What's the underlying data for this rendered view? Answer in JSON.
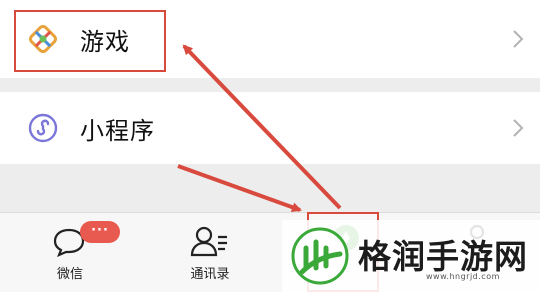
{
  "menu": {
    "games_label": "游戏",
    "mini_programs_label": "小程序"
  },
  "tabbar": {
    "chats_label": "微信",
    "chats_badge": "···",
    "contacts_label": "通讯录"
  },
  "watermark": {
    "brand": "格润手游网",
    "url": "www.hngrjd.com"
  },
  "colors": {
    "annotation_red": "#d94a3e",
    "badge_red": "#e85a4f",
    "accent_green": "#3aa93a"
  },
  "icons": {
    "games": "games-icon",
    "mini_programs": "mini-programs-icon",
    "chevron": "chevron-right-icon",
    "chats": "chat-bubble-icon",
    "contacts": "contacts-icon",
    "discover": "compass-icon",
    "me": "person-icon"
  }
}
